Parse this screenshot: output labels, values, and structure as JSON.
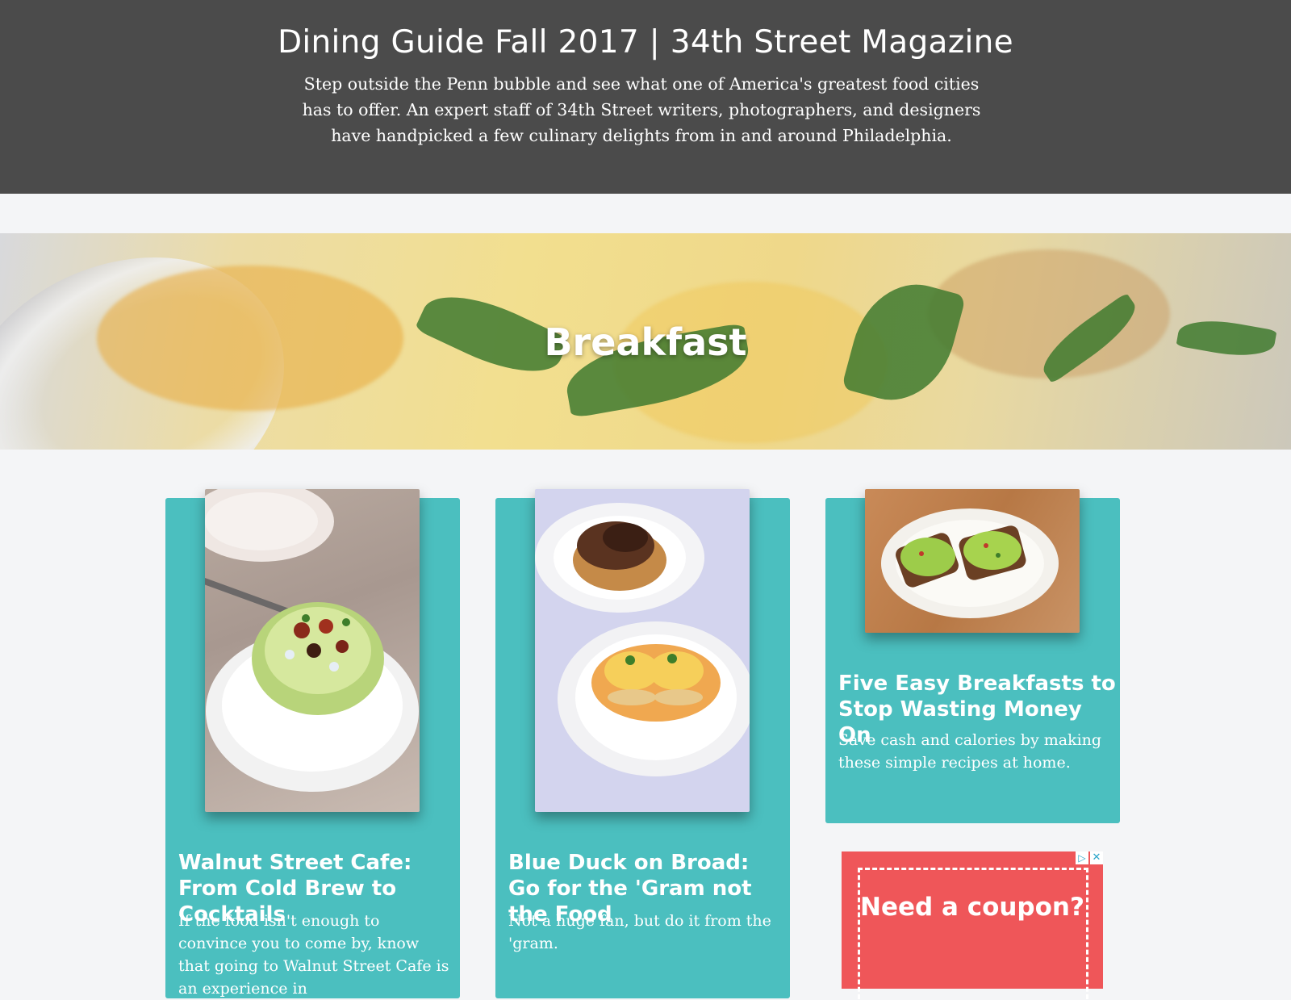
{
  "header": {
    "title": "Dining Guide Fall 2017 | 34th Street Magazine",
    "subtitle": "Step outside the Penn bubble and see what one of America's greatest food cities has to offer. An expert staff of 34th Street writers, photographers, and designers have handpicked a few culinary delights from in and around Philadelphia."
  },
  "section": {
    "heading": "Breakfast"
  },
  "articles": [
    {
      "title": "Walnut Street Cafe: From Cold Brew to Cocktails",
      "description": "If the food isn't enough to convince you to come by, know that going to Walnut Street Cafe is an experience in"
    },
    {
      "title": "Blue Duck on Broad: Go for the 'Gram not the Food",
      "description": "Not a huge fan, but do it from the 'gram."
    },
    {
      "title": "Five Easy Breakfasts to Stop Wasting Money On",
      "description": "Save cash and calories by making these simple recipes at home."
    }
  ],
  "ad": {
    "text": "Need a coupon?",
    "adchoices_icon": "▷",
    "close_icon": "✕"
  },
  "colors": {
    "header_bg": "#4b4b4b",
    "card_bg": "#4bbfbf",
    "ad_bg": "#ef5659"
  }
}
